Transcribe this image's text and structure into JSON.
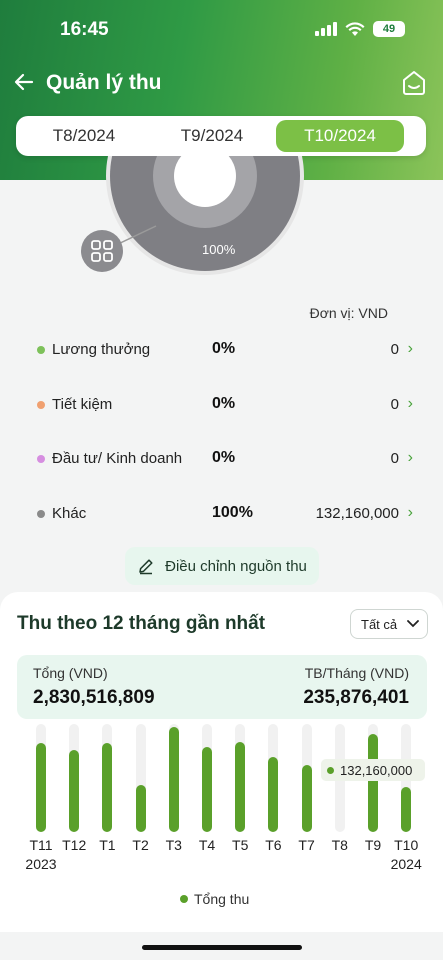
{
  "status": {
    "time": "16:45",
    "battery": "49"
  },
  "nav": {
    "title": "Quản lý thu"
  },
  "tabs": [
    {
      "label": "T8/2024",
      "active": false
    },
    {
      "label": "T9/2024",
      "active": false
    },
    {
      "label": "T10/2024",
      "active": true
    }
  ],
  "donut": {
    "label": "100%"
  },
  "unit_label": "Đơn vị: VND",
  "categories": [
    {
      "label": "Lương thưởng",
      "percent": "0%",
      "amount": "0",
      "color": "#7dc15a"
    },
    {
      "label": "Tiết kiệm",
      "percent": "0%",
      "amount": "0",
      "color": "#f0a070"
    },
    {
      "label": "Đầu tư/ Kinh doanh",
      "percent": "0%",
      "amount": "0",
      "color": "#d68ee0"
    },
    {
      "label": "Khác",
      "percent": "100%",
      "amount": "132,160,000",
      "color": "#8a8a8a"
    }
  ],
  "adjust_button": "Điều chỉnh nguồn thu",
  "card": {
    "title": "Thu theo 12 tháng gần nhất",
    "filter": "Tất cả",
    "total_label": "Tổng (VND)",
    "total_value": "2,830,516,809",
    "avg_label": "TB/Tháng (VND)",
    "avg_value": "235,876,401"
  },
  "chart_data": {
    "type": "bar",
    "categories": [
      "T11",
      "T12",
      "T1",
      "T2",
      "T3",
      "T4",
      "T5",
      "T6",
      "T7",
      "T8",
      "T9",
      "T10"
    ],
    "year_labels": {
      "T11": "2023",
      "T10": "2024"
    },
    "series": [
      {
        "name": "Tổng thu",
        "values": [
          264000000,
          244000000,
          264000000,
          138000000,
          312000000,
          253000000,
          268000000,
          223000000,
          199000000,
          0,
          290000000,
          132160000
        ]
      }
    ],
    "tooltip": "132,160,000",
    "legend": "bottom",
    "color": "#5aa02a"
  }
}
